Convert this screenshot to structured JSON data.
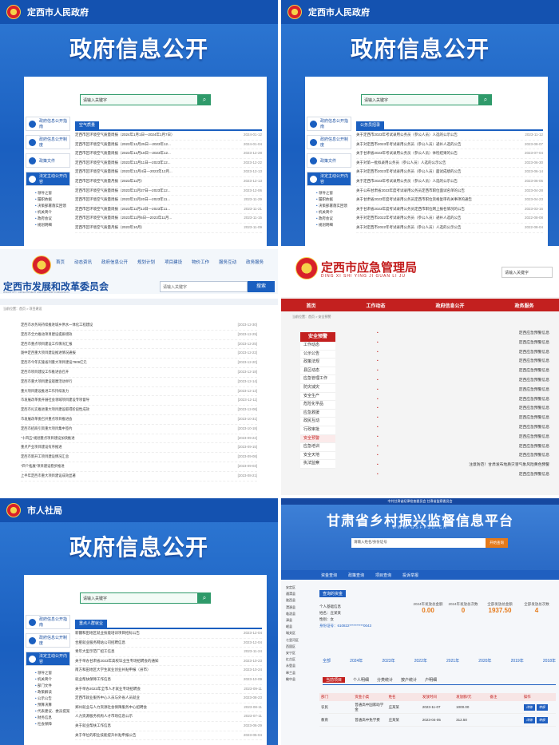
{
  "p1": {
    "top_title": "定西市人民政府",
    "big_title": "政府信息公开",
    "search_placeholder": "请输入关键字",
    "nav": [
      "政府信息公开指南",
      "政府信息公开制度",
      "政策文件",
      "法定主动公开内容"
    ],
    "subnav": [
      "领导之窗",
      "履职依据",
      "决策部署落实回馈",
      "机关简介",
      "政府会议",
      "规划明细"
    ],
    "list_head": "空气质量",
    "rows": [
      [
        "定西市区环境空气质量周报（2024年1月1日—2024年1月7日）",
        "2024-01-12"
      ],
      [
        "定西市区环境空气质量周报（2023年12月25日—2023年12...",
        "2024-01-04"
      ],
      [
        "定西市区环境空气质量周报（2023年12月18日—2023年12...",
        "2023-12-28"
      ],
      [
        "定西市区环境空气质量周报（2023年12月11日—2023年12...",
        "2023-12-22"
      ],
      [
        "定西市区环境空气质量周报（2023年12月4日—2023年12月...",
        "2023-12-13"
      ],
      [
        "定西市区环境空气质量月报（2023年11月）",
        "2023-12-13"
      ],
      [
        "定西市区环境空气质量周报（2023年11月27日—2023年12...",
        "2023-12-06"
      ],
      [
        "定西市区环境空气质量周报（2023年11月20日—2023年11...",
        "2023-11-29"
      ],
      [
        "定西市区环境空气质量周报（2023年11月13日—2023年11...",
        "2023-11-21"
      ],
      [
        "定西市区环境空气质量周报（2023年11月6日—2023年11月...",
        "2023-11-15"
      ],
      [
        "定西市区环境空气质量月报（2023年10月）",
        "2023-11-09"
      ]
    ]
  },
  "p2": {
    "top_title": "定西市人民政府",
    "big_title": "政府信息公开",
    "search_placeholder": "请输入关键字",
    "nav": [
      "政府信息公开指南",
      "政府信息公开制度",
      "政策文件",
      "法定主动公开内容"
    ],
    "subnav": [
      "领导之窗",
      "履职依据",
      "决策部署落实回馈",
      "机关简介",
      "政府会议",
      "规划明细"
    ],
    "list_head": "公务员招录",
    "rows": [
      [
        "关于定西市2023年考试录用公务员（参公人员）人选的公示公告",
        "2023-11-12"
      ],
      [
        "关于对定西市2023年考试录用公务员（参公人员）递补人选的公告",
        "2023-08-07"
      ],
      [
        "关于甘肃省2023年考试录用公务员（参公人员）体检结果的公告",
        "2023-07-04"
      ],
      [
        "关于对第一批拟录用公务员（参公人员）人选的公示公告",
        "2023-06-30"
      ],
      [
        "关于对定西市2023年考试录用公务员（参公人员）面试成绩的公告",
        "2023-06-14"
      ],
      [
        "关于定西市2023年考试录用公务员（参公人员）人选的公示公告",
        "2023-06-05"
      ],
      [
        "关于公布甘肃省2023年度考试录用公务员定西市职位面试名单的公告",
        "2023-04-28"
      ],
      [
        "关于甘肃省2023年度考试录用公务员定西市职位资格复审有关事项的通告",
        "2023-04-23"
      ],
      [
        "关于甘肃省2023年度考试录用公务员定西市职位网上报名情况的公告",
        "2023-03-16"
      ],
      [
        "关于对定西市2022年考试录用公务员（参公人员）递补人选的公告",
        "2022-08-08"
      ],
      [
        "关于对定西市2022年考试录用公务员（参公人员）人选的公示公告",
        "2022-08-04"
      ]
    ]
  },
  "p3": {
    "nav": [
      "首页",
      "动态资讯",
      "政府信息公开",
      "规划计划",
      "项目建设",
      "物价工作",
      "服务互动",
      "政务服务"
    ],
    "title": "定西市发展和改革委员会",
    "subtitle": "DINGXI CITY DEVELOPMENT AND REFORM COMMISSION",
    "search_placeholder": "请输入关键字",
    "search_btn": "搜索",
    "crumb": "当前位置：首页 > 项目建设",
    "rows": [
      [
        "定西市水务局持续推进城乡供水一体化工程建设",
        "[2023-12-30]"
      ],
      [
        "定西市全力推动项目建设提质增效",
        "[2023-12-29]"
      ],
      [
        "定西市重点项目建设工作情况汇报",
        "[2023-12-25]"
      ],
      [
        "陇中定西重大项目建设推进情况通报",
        "[2023-12-22]"
      ],
      [
        "定西市今年实施省列重大项目建设7909亿元",
        "[2023-12-20]"
      ],
      [
        "定西市项目建设工作推进会召开",
        "[2023-12-18]"
      ],
      [
        "定西市重大项目建设观摩活动举行",
        "[2023-12-14]"
      ],
      [
        "重大项目建设推进工作持续发力",
        "[2023-12-13]"
      ],
      [
        "市发展改革委开展社会领域项目建设专项督导",
        "[2023-12-11]"
      ],
      [
        "定西市扎实推进重大项目建设取得阶段性成效",
        "[2023-12-08]"
      ],
      [
        "市发展改革委召开重点项目推进会",
        "[2023-10-31]"
      ],
      [
        "定西市招商引资重大项目集中签约",
        "[2023-10-18]"
      ],
      [
        "\"十四五\"规划重点项目建设加快推进",
        "[2023-09-22]"
      ],
      [
        "重点产业项目建设有序推进",
        "[2023-09-15]"
      ],
      [
        "定西市新开工项目建设情况汇总",
        "[2023-09-08]"
      ],
      [
        "\"四个拓展\"项目建设稳步推进",
        "[2023-09-03]"
      ],
      [
        "上半年定西市重大项目建设成效显著",
        "[2023-08-21]"
      ]
    ]
  },
  "p4": {
    "title": "定西市应急管理局",
    "pinyin": "DING XI SHI YING JI GUAN LI JU",
    "search_placeholder": "请输入关键字",
    "nav": [
      "首页",
      "工作动态",
      "政府信息公开",
      "政务服务"
    ],
    "crumb": "当前位置：首页 > 安全预警",
    "side_head": "安全预警",
    "side": [
      "工作动态",
      "公示公告",
      "政策法规",
      "县区动态",
      "应急管理工作",
      "防灾减灾",
      "安全生产",
      "危险化学品",
      "应急救援",
      "政民互动",
      "行政审批",
      "安全预警",
      "应急培训",
      "安全天地",
      "执法监察"
    ],
    "rows": [
      "定西应急预警信息",
      "定西应急预警信息",
      "定西应急预警信息",
      "定西应急预警信息",
      "定西应急预警信息",
      "定西应急预警信息",
      "定西应急预警信息",
      "定西应急预警信息",
      "定西应急预警信息",
      "定西应急预警信息",
      "定西应急预警信息",
      "定西应急预警信息",
      "定西应急预警信息",
      "定西应急预警信息",
      "注意防范！甘肃发布地质灾害气象风险黄色预警",
      "定西应急预警信息"
    ]
  },
  "p5": {
    "top_title": "市人社局",
    "big_title": "政府信息公开",
    "search_placeholder": "请输入关键字",
    "nav": [
      "政府信息公开指南",
      "政府信息公开制度",
      "法定主动公开内容"
    ],
    "subnav": [
      "领导之窗",
      "机关简介",
      "部门文件",
      "政策解读",
      "公示公告",
      "预算决算",
      "代表建议、委员提案",
      "财务信息",
      "社会保障"
    ],
    "list_head": "重点人群就业",
    "rows": [
      [
        "新疆和田地区就业技能培训项目招标公告",
        "2023-12-04"
      ],
      [
        "合肥就业服务网站公司招聘信息",
        "2023-12-04"
      ],
      [
        "青年大型示范厂招工信息",
        "2023-11-24"
      ],
      [
        "关于举办甘肃省2023年高校毕业生专场招聘会的通知",
        "2023-10-23"
      ],
      [
        "南方和田地区大学生就业创业补贴申报（县市）",
        "2023-10-24"
      ],
      [
        "就业帮扶保障工作信息",
        "2023-10-09"
      ],
      [
        "关于举办2023年全市人才就业专场招聘会",
        "2023-09-11"
      ],
      [
        "定西市就业服务中心人员与外省人员就业",
        "2023-08-23"
      ],
      [
        "郑州就业与人力资源社会保障服务中心招聘会",
        "2023-08-11"
      ],
      [
        "人力资源服务机构人才市场信息公示",
        "2023-07-11"
      ],
      [
        "关于就业帮扶工作信息",
        "2023-06-29"
      ],
      [
        "关于单位的职业技能提升补贴申报公告",
        "2023-05-04"
      ]
    ]
  },
  "p6": {
    "strip": "中共甘肃省纪律检查委员会 甘肃省监察委员会",
    "title": "甘肃省乡村振兴监督信息平台",
    "url": "WWW.GSFPJD.CN",
    "search_placeholder": "请输入姓名/身份证号",
    "search_btn": "开始查询",
    "nav": [
      "资金查询",
      "政策查询",
      "项目查询",
      "投诉举报"
    ],
    "side": [
      "安定区",
      "通渭县",
      "陇西县",
      "渭源县",
      "临洮县",
      "漳县",
      "岷县",
      "城关区",
      "七里河区",
      "西固区",
      "安宁区",
      "红古区",
      "永登县",
      "皋兰县",
      "榆中县"
    ],
    "tab1": "查询的资金",
    "person_label": "个人基础信息",
    "name": "姓名：庄某某",
    "gender": "性别：女",
    "id": "身份证号：610822**********0043",
    "stats": [
      {
        "label": "2024年发放总金额",
        "value": "0.00"
      },
      {
        "label": "2024年发放总次数",
        "value": "0"
      },
      {
        "label": "全部发放总金额",
        "value": "1937.50"
      },
      {
        "label": "全部发放总次数",
        "value": "4"
      }
    ],
    "years": [
      "全部",
      "2024年",
      "2023年",
      "2022年",
      "2021年",
      "2020年",
      "2019年",
      "2018年"
    ],
    "tabs": [
      "当前项目",
      "个人明细",
      "分类统计",
      "按户统计",
      "户明细"
    ],
    "table_head": [
      "部门",
      "资金小类",
      "姓名",
      "发放时间",
      "发放额/元",
      "备注",
      "操作"
    ],
    "table_rows": [
      [
        "农民",
        "普通高中国家助学金",
        "庄某某",
        "2023-11-07",
        "1000.00",
        ""
      ],
      [
        "教育",
        "普通高中免学费",
        "庄某某",
        "2023-04-05",
        "312.50",
        ""
      ]
    ]
  }
}
